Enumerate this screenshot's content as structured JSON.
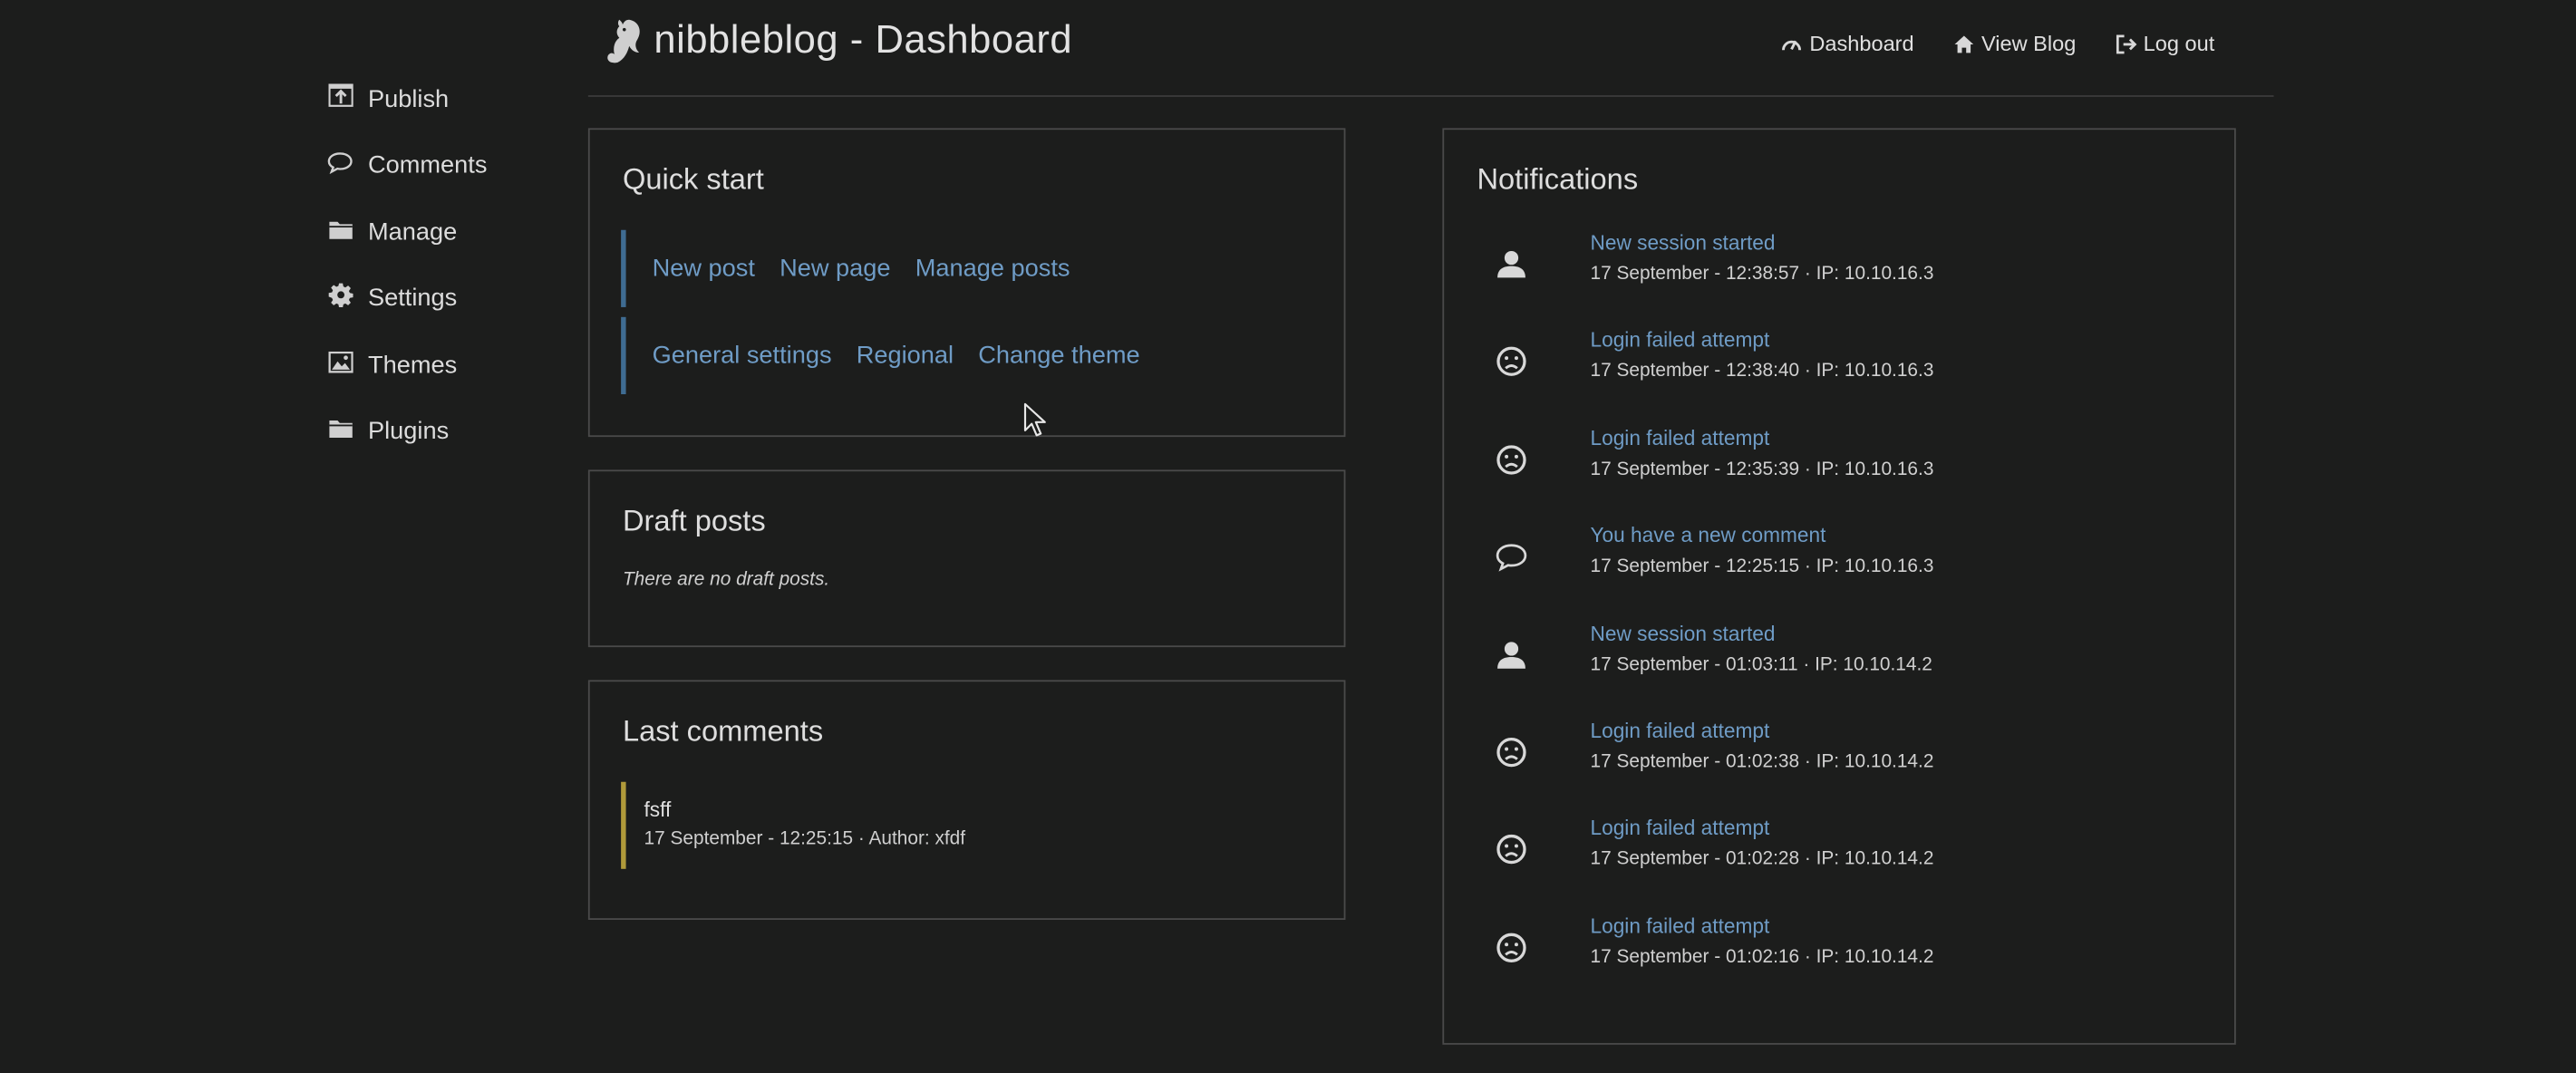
{
  "header": {
    "title": "nibbleblog - Dashboard",
    "nav": [
      {
        "label": "Dashboard",
        "icon": "dashboard-gauge-icon"
      },
      {
        "label": "View Blog",
        "icon": "home-icon"
      },
      {
        "label": "Log out",
        "icon": "logout-icon"
      }
    ]
  },
  "sidebar": {
    "items": [
      {
        "label": "Publish",
        "icon": "publish-icon"
      },
      {
        "label": "Comments",
        "icon": "comment-icon"
      },
      {
        "label": "Manage",
        "icon": "folder-icon"
      },
      {
        "label": "Settings",
        "icon": "gear-icon"
      },
      {
        "label": "Themes",
        "icon": "image-icon"
      },
      {
        "label": "Plugins",
        "icon": "folder-icon"
      }
    ]
  },
  "quick_start": {
    "title": "Quick start",
    "row1": [
      "New post",
      "New page",
      "Manage posts"
    ],
    "row2": [
      "General settings",
      "Regional",
      "Change theme"
    ]
  },
  "draft_posts": {
    "title": "Draft posts",
    "empty_text": "There are no draft posts."
  },
  "last_comments": {
    "title": "Last comments",
    "items": [
      {
        "title": "fsff",
        "meta": "17 September - 12:25:15 · Author: xfdf"
      }
    ]
  },
  "notifications": {
    "title": "Notifications",
    "items": [
      {
        "type": "session",
        "title": "New session started",
        "meta": "17 September - 12:38:57 · IP: 10.10.16.3"
      },
      {
        "type": "failed",
        "title": "Login failed attempt",
        "meta": "17 September - 12:38:40 · IP: 10.10.16.3"
      },
      {
        "type": "failed",
        "title": "Login failed attempt",
        "meta": "17 September - 12:35:39 · IP: 10.10.16.3"
      },
      {
        "type": "comment",
        "title": "You have a new comment",
        "meta": "17 September - 12:25:15 · IP: 10.10.16.3"
      },
      {
        "type": "session",
        "title": "New session started",
        "meta": "17 September - 01:03:11 · IP: 10.10.14.2"
      },
      {
        "type": "failed",
        "title": "Login failed attempt",
        "meta": "17 September - 01:02:38 · IP: 10.10.14.2"
      },
      {
        "type": "failed",
        "title": "Login failed attempt",
        "meta": "17 September - 01:02:28 · IP: 10.10.14.2"
      },
      {
        "type": "failed",
        "title": "Login failed attempt",
        "meta": "17 September - 01:02:16 · IP: 10.10.14.2"
      }
    ]
  },
  "colors": {
    "background": "#1c1d1c",
    "link": "#6f9cc6",
    "quickstart_accent": "#3f6c92",
    "comment_accent": "#b09a3a"
  }
}
